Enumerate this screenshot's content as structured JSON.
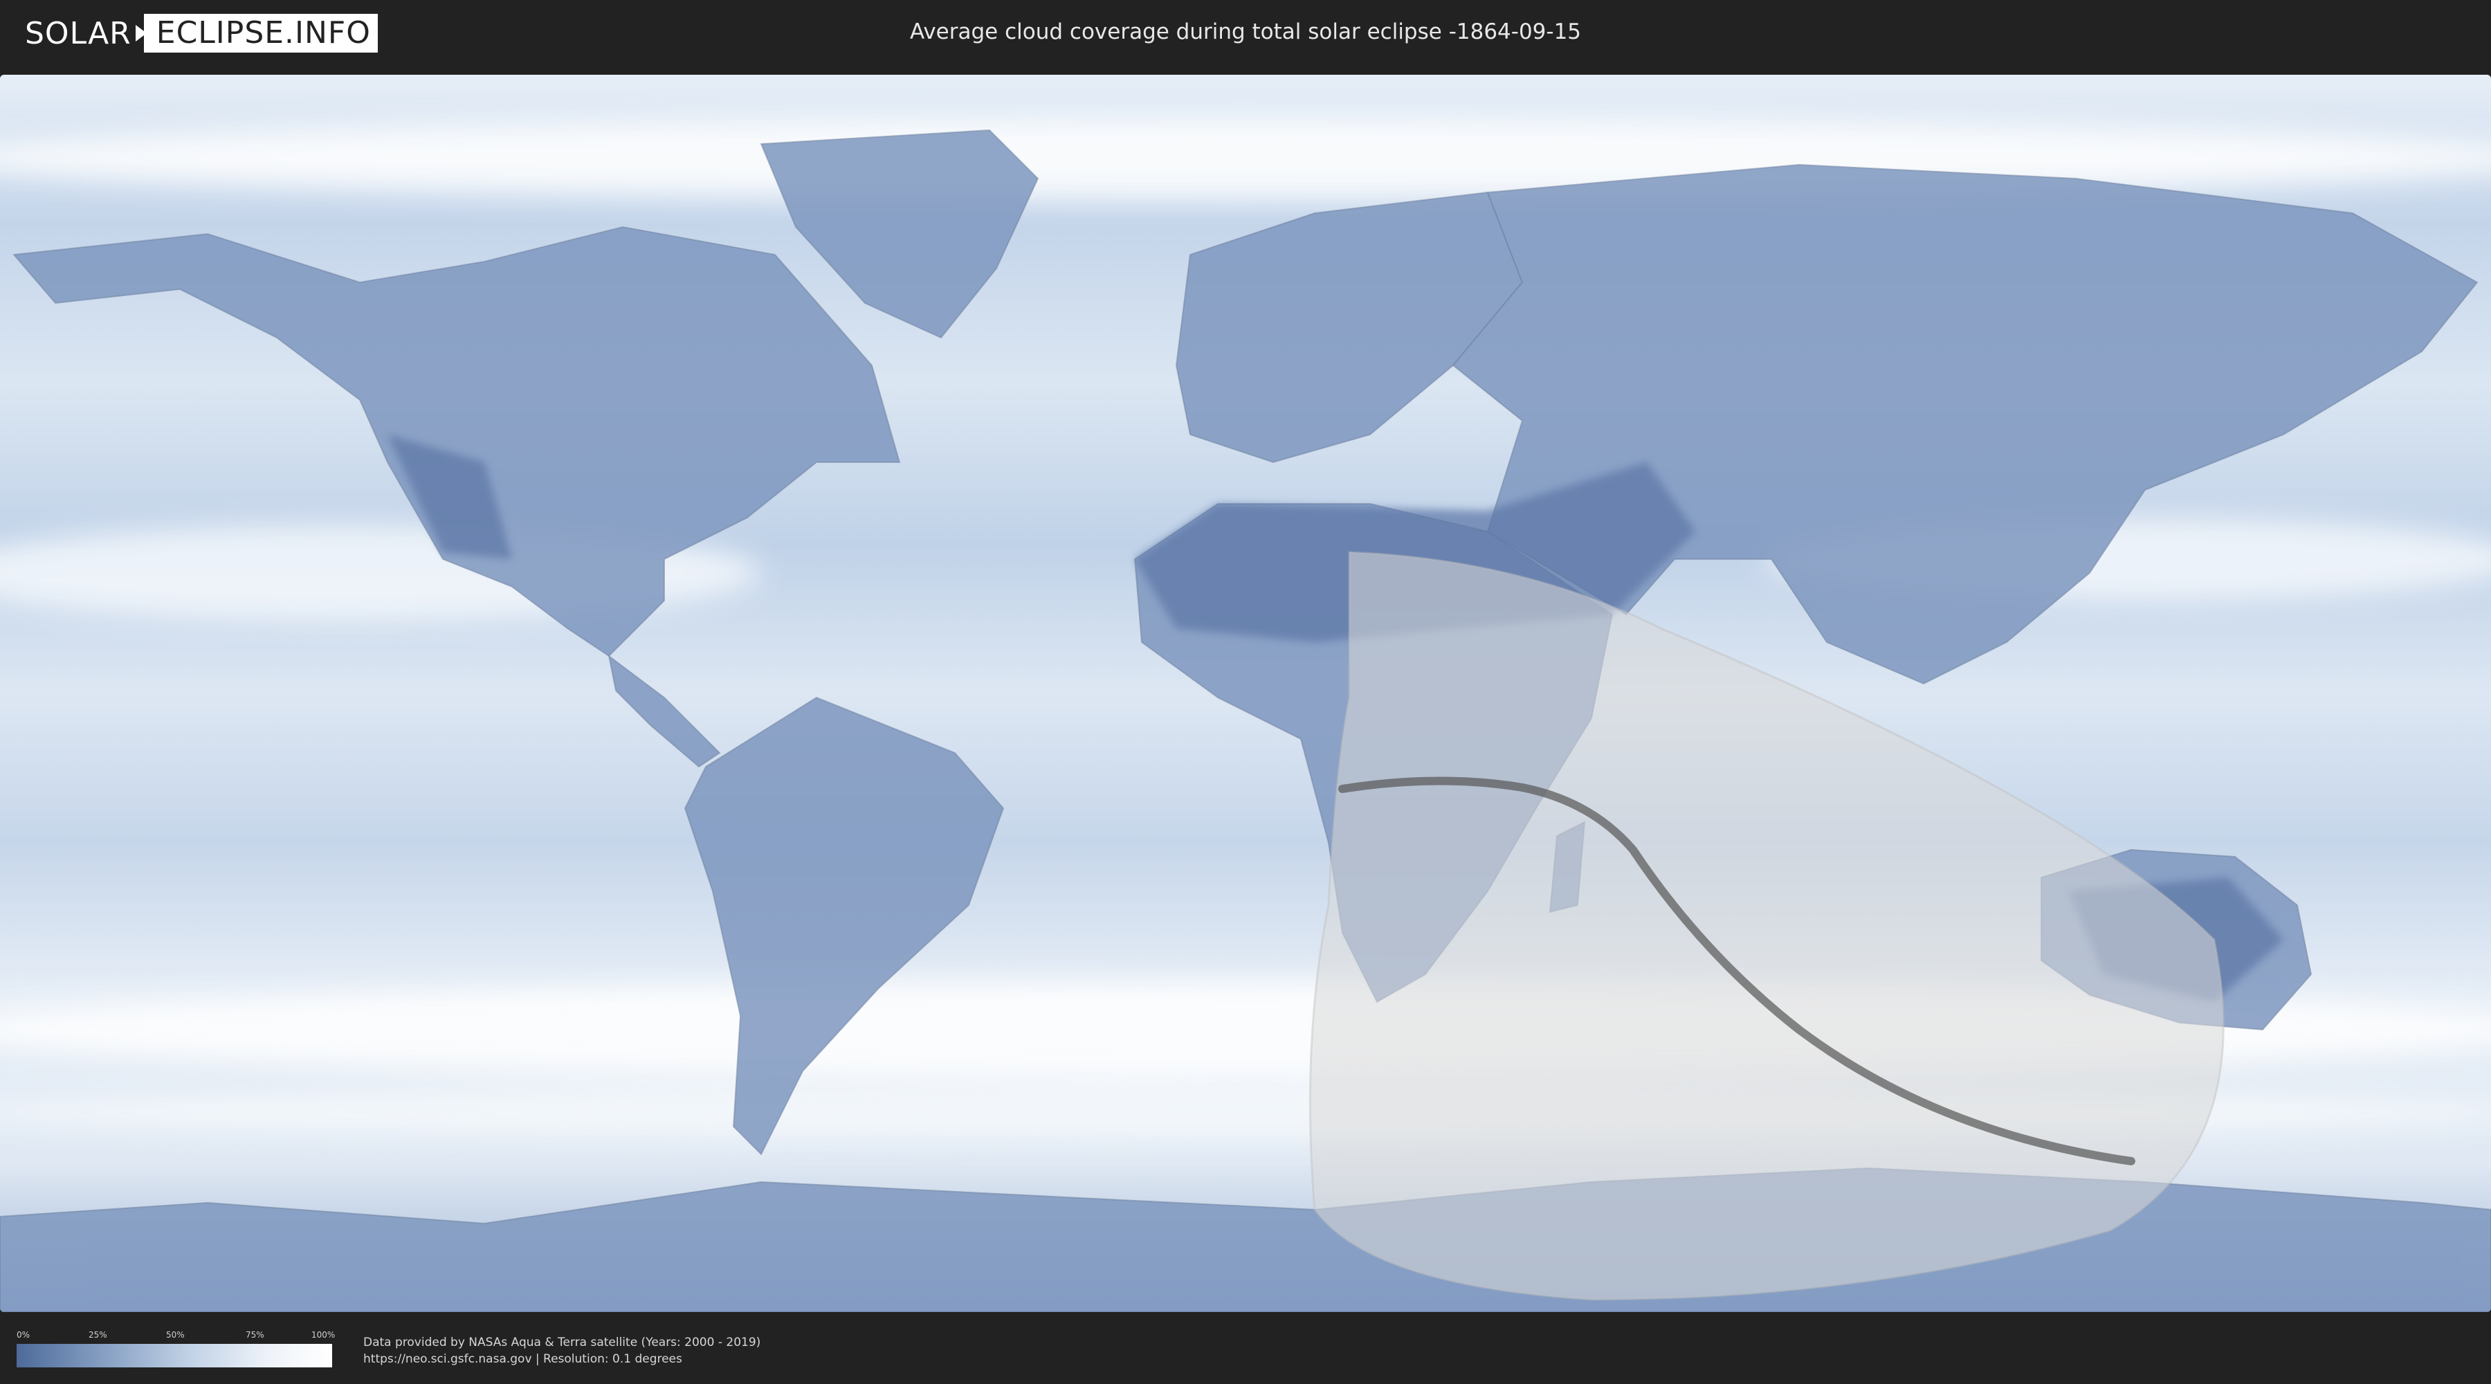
{
  "logo": {
    "part_a": "SOLAR",
    "part_b": "ECLIPSE.INFO"
  },
  "title": "Average cloud coverage during total solar eclipse -1864-09-15",
  "legend": {
    "ticks": [
      "0%",
      "25%",
      "50%",
      "75%",
      "100%"
    ]
  },
  "credits": {
    "line1": "Data provided by NASAs Aqua & Terra satellite (Years: 2000 - 2019)",
    "line2": "https://neo.sci.gsfc.nasa.gov | Resolution: 0.1 degrees"
  },
  "colors": {
    "background": "#222222",
    "ocean": "#cfe0ef",
    "land_dark": "#6d87b3",
    "cloud": "#ffffff",
    "eclipse_shadow": "#d8d8d8",
    "eclipse_path": "#555555"
  }
}
